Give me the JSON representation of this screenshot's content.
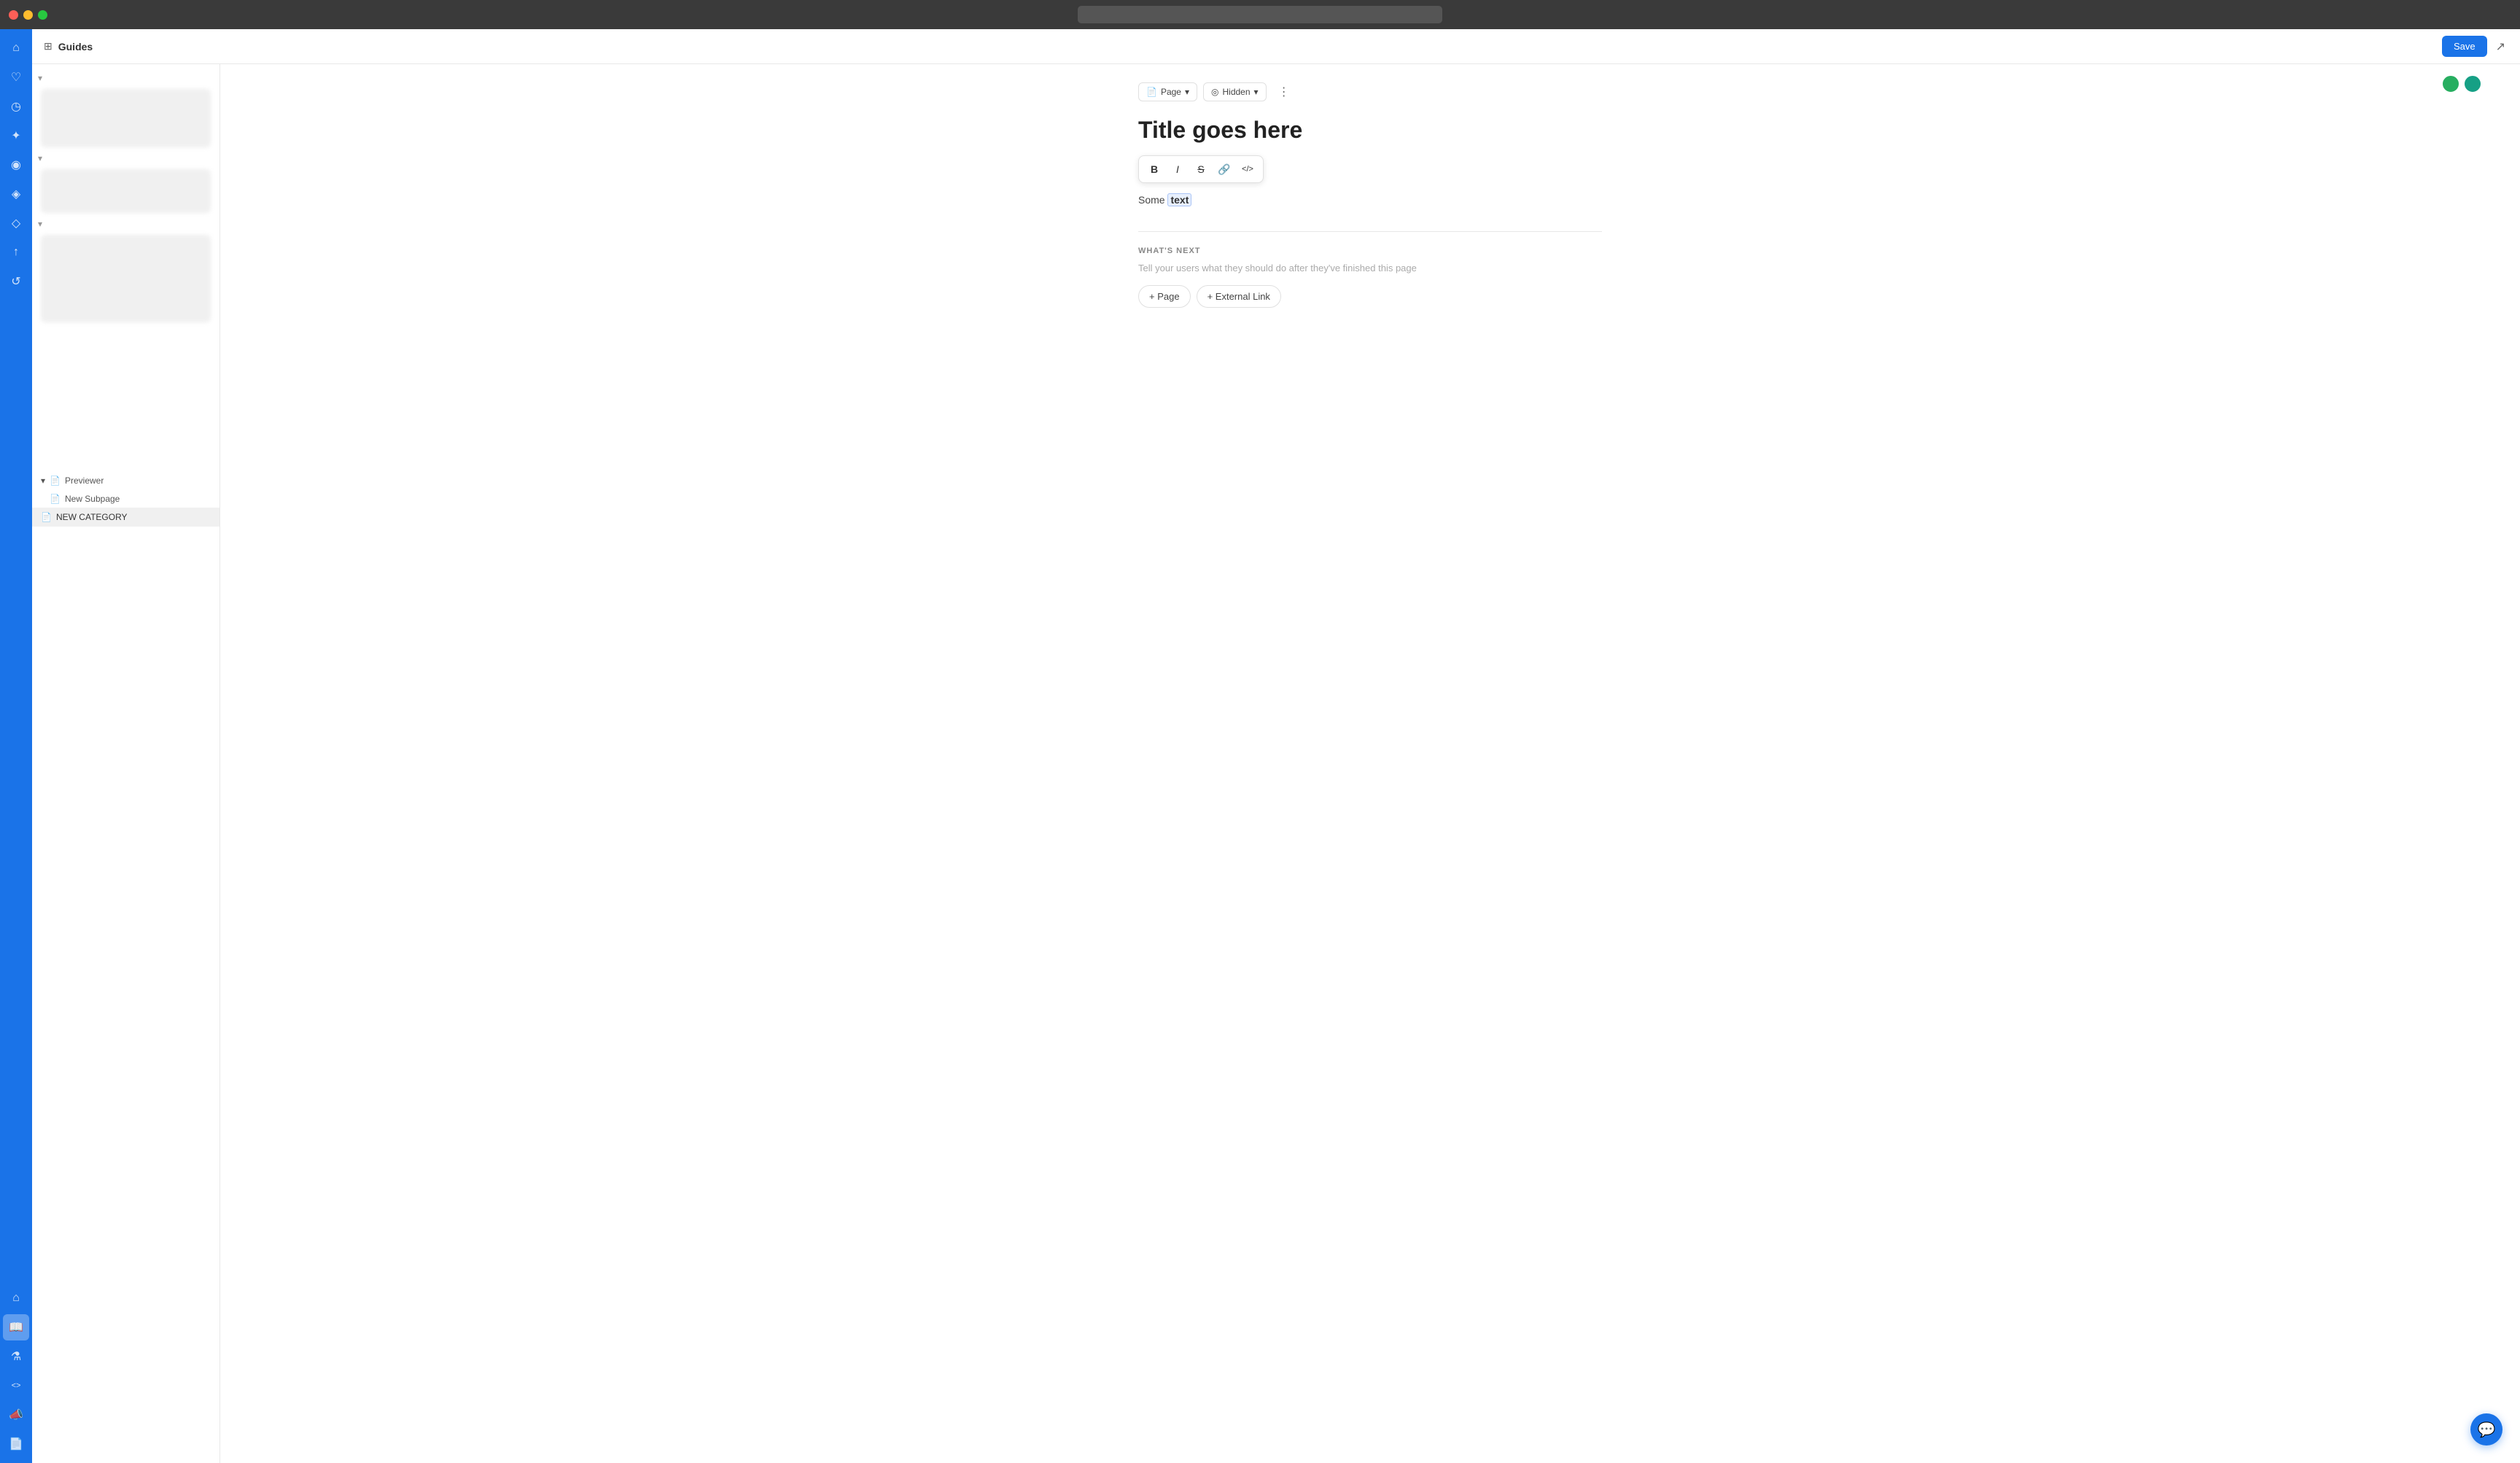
{
  "titlebar": {
    "dots": [
      "red",
      "yellow",
      "green"
    ]
  },
  "header": {
    "grid_icon": "⊞",
    "title": "Guides",
    "save_label": "Save",
    "share_icon": "↗"
  },
  "sidebar_icons": {
    "items": [
      {
        "name": "home",
        "icon": "⌂",
        "active": false
      },
      {
        "name": "heart",
        "icon": "♡",
        "active": false
      },
      {
        "name": "clock",
        "icon": "◷",
        "active": false
      },
      {
        "name": "wrench",
        "icon": "✦",
        "active": false
      },
      {
        "name": "eye",
        "icon": "◉",
        "active": false
      },
      {
        "name": "gift",
        "icon": "◈",
        "active": false
      },
      {
        "name": "tag",
        "icon": "◇",
        "active": false
      },
      {
        "name": "rocket",
        "icon": "↑",
        "active": false
      },
      {
        "name": "recycle",
        "icon": "↺",
        "active": false
      },
      {
        "name": "home2",
        "icon": "⌂",
        "active": false
      },
      {
        "name": "book",
        "icon": "📖",
        "active": true
      },
      {
        "name": "flask",
        "icon": "⚗",
        "active": false
      },
      {
        "name": "code",
        "icon": "<>",
        "active": false
      },
      {
        "name": "megaphone",
        "icon": "📣",
        "active": false
      },
      {
        "name": "file",
        "icon": "📄",
        "active": false
      }
    ]
  },
  "page_controls": {
    "page_btn": "Page",
    "hidden_btn": "Hidden",
    "more_icon": "⋮",
    "page_icon": "📄",
    "hidden_icon": "◎"
  },
  "editor": {
    "title": "Title goes here",
    "text_before": "Some ",
    "text_highlighted": "text",
    "text_after": ""
  },
  "format_toolbar": {
    "bold": "B",
    "italic": "I",
    "strikethrough": "S",
    "link": "🔗",
    "code": "</>"
  },
  "whats_next": {
    "heading": "WHAT'S NEXT",
    "description": "Tell your users what they should do after they've finished this page",
    "page_btn": "+ Page",
    "external_link_btn": "+ External Link"
  },
  "bottom_panel": {
    "previewer_label": "Previewer",
    "new_subpage_label": "New Subpage",
    "new_category_label": "NEW CATEGORY"
  }
}
